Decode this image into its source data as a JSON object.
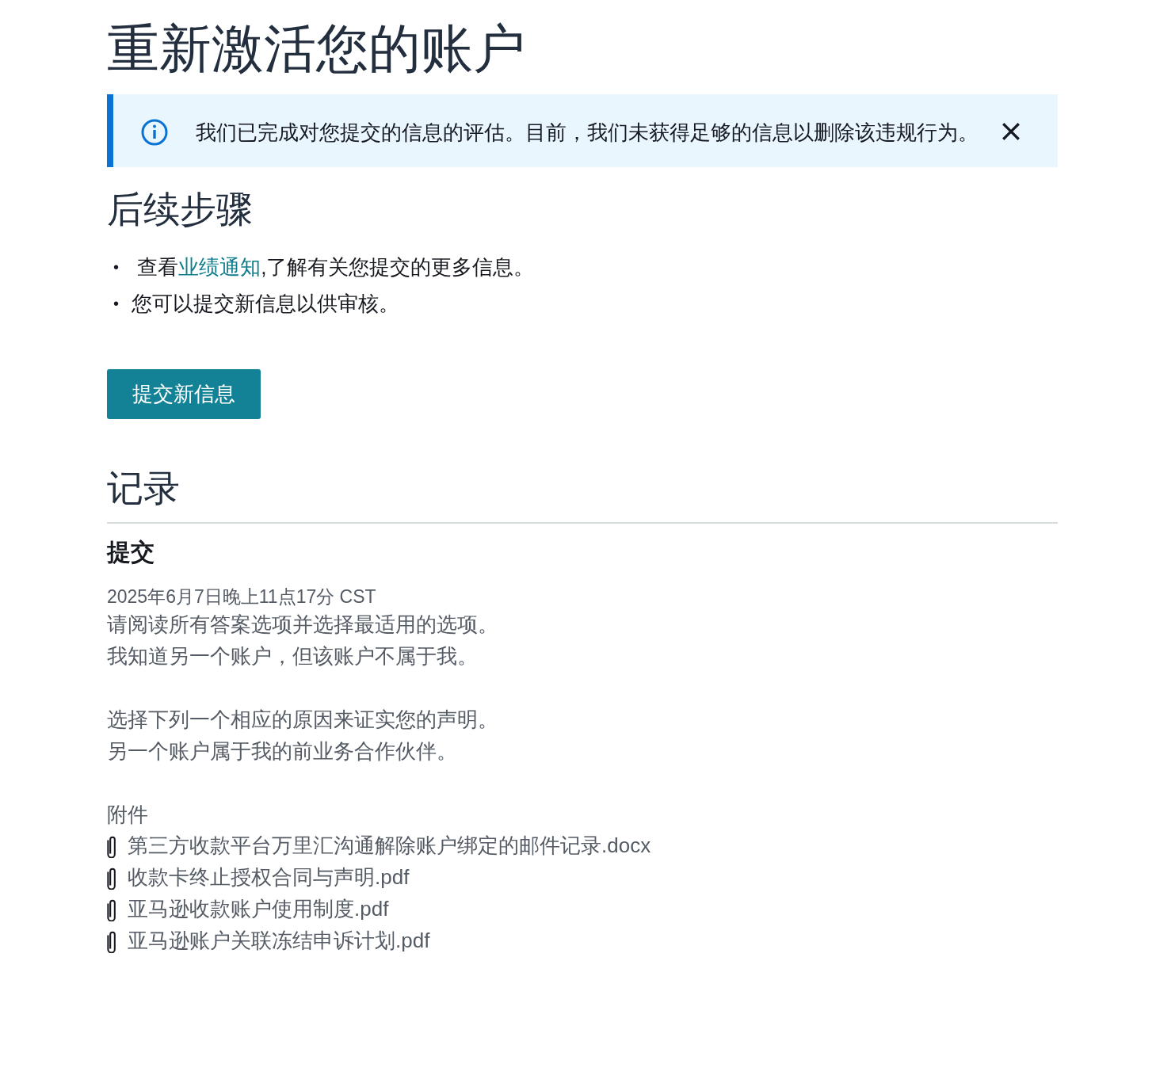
{
  "title": "重新激活您的账户",
  "alert": {
    "message": "我们已完成对您提交的信息的评估。目前，我们未获得足够的信息以删除该违规行为。",
    "dismissible": true
  },
  "next_steps": {
    "heading": "后续步骤",
    "items": [
      {
        "bullet": "•",
        "before": " 查看",
        "link": "业绩通知",
        "after": ",了解有关您提交的更多信息。"
      },
      {
        "bullet": "•",
        "before": "您可以提交新信息以供审核。"
      }
    ],
    "button": "提交新信息"
  },
  "records": {
    "heading": "记录",
    "entries": [
      {
        "title": "提交",
        "timestamp": "2025年6月7日晚上11点17分 CST",
        "paragraphs": [
          [
            "请阅读所有答案选项并选择最适用的选项。",
            "我知道另一个账户，但该账户不属于我。"
          ],
          [
            "选择下列一个相应的原因来证实您的声明。",
            "另一个账户属于我的前业务合作伙伴。"
          ]
        ],
        "attachments_label": "附件",
        "attachments": [
          "第三方收款平台万里汇沟通解除账户绑定的邮件记录.docx",
          "收款卡终止授权合同与声明.pdf",
          "亚马逊收款账户使用制度.pdf",
          "亚马逊账户关联冻结申诉计划.pdf"
        ]
      }
    ]
  }
}
